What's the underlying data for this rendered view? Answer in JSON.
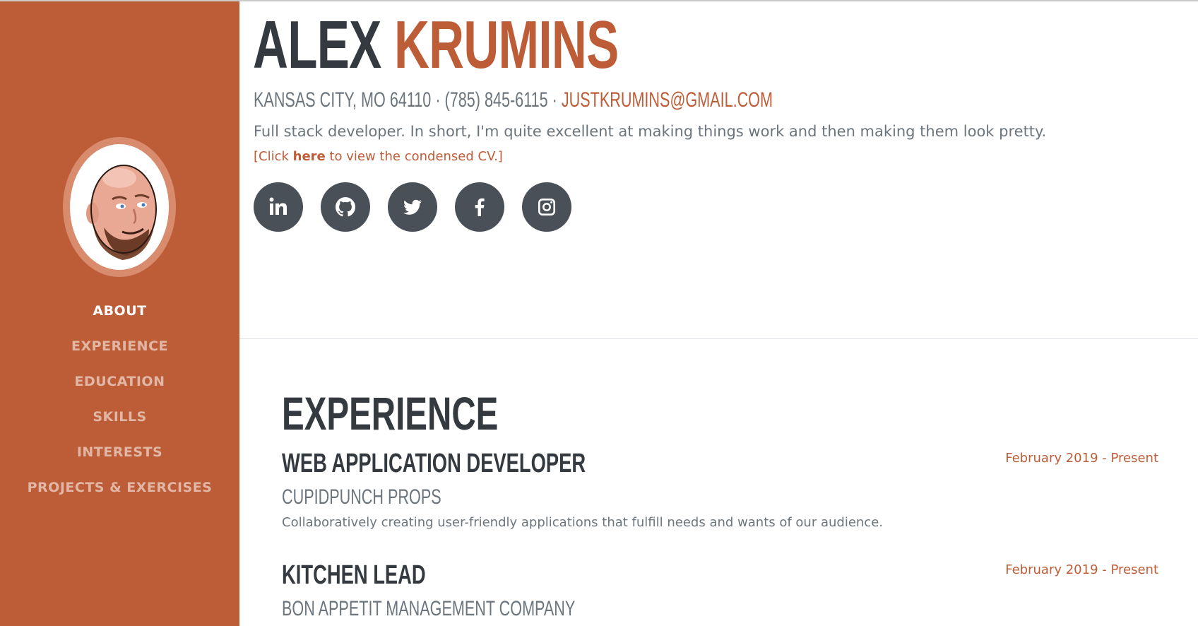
{
  "profile": {
    "first_name": "ALEX",
    "last_name": "KRUMINS",
    "location": "KANSAS CITY, MO 64110",
    "phone": "(785) 845-6115",
    "separator": " · ",
    "email": "JUSTKRUMINS@GMAIL.COM",
    "lead": "Full stack developer. In short, I'm quite excellent at making things work and then making them look pretty.",
    "cv_prefix": "[Click ",
    "cv_link": "here",
    "cv_suffix": " to view the condensed CV.]"
  },
  "nav": {
    "items": [
      {
        "label": "ABOUT",
        "active": true
      },
      {
        "label": "EXPERIENCE"
      },
      {
        "label": "EDUCATION"
      },
      {
        "label": "SKILLS"
      },
      {
        "label": "INTERESTS"
      },
      {
        "label": "PROJECTS & EXERCISES"
      }
    ]
  },
  "social": {
    "icons": [
      "linkedin-icon",
      "github-icon",
      "twitter-icon",
      "facebook-icon",
      "instagram-icon"
    ]
  },
  "experience": {
    "title": "EXPERIENCE",
    "jobs": [
      {
        "title": "WEB APPLICATION DEVELOPER",
        "company": "CUPIDPUNCH PROPS",
        "description": "Collaboratively creating user-friendly applications that fulfill needs and wants of our audience.",
        "date": "February 2019 - Present"
      },
      {
        "title": "KITCHEN LEAD",
        "company": "BON APPETIT MANAGEMENT COMPANY",
        "date": "February 2019 - Present"
      }
    ]
  },
  "colors": {
    "accent": "#bd5d38",
    "dark": "#343a40",
    "muted": "#6c757d",
    "icon_bg": "#495057"
  }
}
